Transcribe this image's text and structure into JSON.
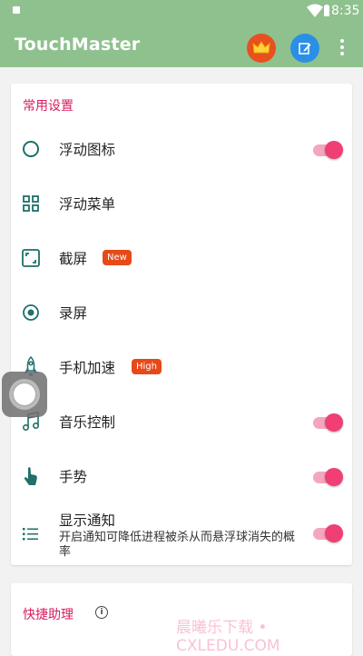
{
  "status_bar": {
    "time": "8:35"
  },
  "app_bar": {
    "title": "TouchMaster",
    "vip_icon": "crown-icon",
    "edit_icon": "edit-icon",
    "more_icon": "more-vert-icon",
    "colors": {
      "bar": "#8fc18f",
      "vip": "#e8501f",
      "edit": "#2b8fe6"
    }
  },
  "common_settings": {
    "title": "常用设置",
    "items": [
      {
        "label": "浮动图标",
        "icon": "circle-outline-icon",
        "toggle": true
      },
      {
        "label": "浮动菜单",
        "icon": "grid-menu-icon"
      },
      {
        "label": "截屏",
        "icon": "screenshot-icon",
        "badge": "New"
      },
      {
        "label": "录屏",
        "icon": "record-icon"
      },
      {
        "label": "手机加速",
        "icon": "rocket-icon",
        "badge": "High"
      },
      {
        "label": "音乐控制",
        "icon": "music-note-icon",
        "toggle": true
      },
      {
        "label": "手势",
        "icon": "gesture-hand-icon",
        "toggle": true
      },
      {
        "label": "显示通知",
        "sublabel": "开启通知可降低进程被杀从而悬浮球消失的概率",
        "icon": "list-icon",
        "toggle": true
      }
    ]
  },
  "quick_assistant": {
    "title": "快捷助理",
    "info_icon": "info-icon",
    "info_glyph": "i"
  },
  "watermark": "晨曦乐下载 • CXLEDU.COM",
  "accent_colors": {
    "section_title": "#d81b60",
    "toggle_on": "#ef3f74",
    "badge": "#e64a19",
    "icon": "#1f6f6a"
  }
}
